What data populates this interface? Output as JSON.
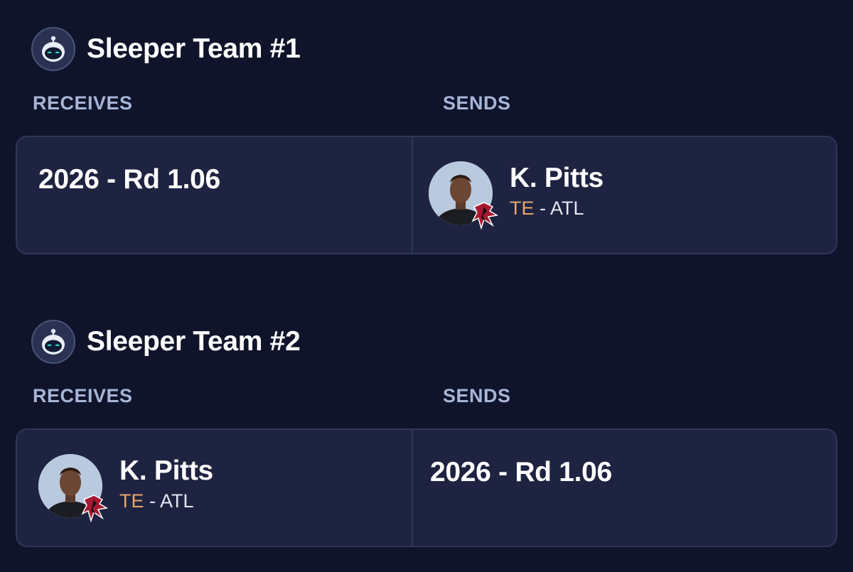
{
  "teams": [
    {
      "name": "Sleeper Team #1",
      "avatar_icon": "robot-helmet-icon",
      "receives_label": "RECEIVES",
      "sends_label": "SENDS",
      "receives": {
        "kind": "pick",
        "text": "2026 - Rd 1.06"
      },
      "sends": {
        "kind": "player",
        "name": "K. Pitts",
        "position": "TE",
        "separator": " - ",
        "team": "ATL",
        "team_logo_icon": "falcons-logo-icon"
      }
    },
    {
      "name": "Sleeper Team #2",
      "avatar_icon": "robot-helmet-icon",
      "receives_label": "RECEIVES",
      "sends_label": "SENDS",
      "receives": {
        "kind": "player",
        "name": "K. Pitts",
        "position": "TE",
        "separator": " - ",
        "team": "ATL",
        "team_logo_icon": "falcons-logo-icon"
      },
      "sends": {
        "kind": "pick",
        "text": "2026 - Rd 1.06"
      }
    }
  ],
  "colors": {
    "background": "#10142b",
    "card": "#1e2341",
    "card_border": "#2f3658",
    "label": "#a7b5d6",
    "position_te": "#e8a66a"
  }
}
